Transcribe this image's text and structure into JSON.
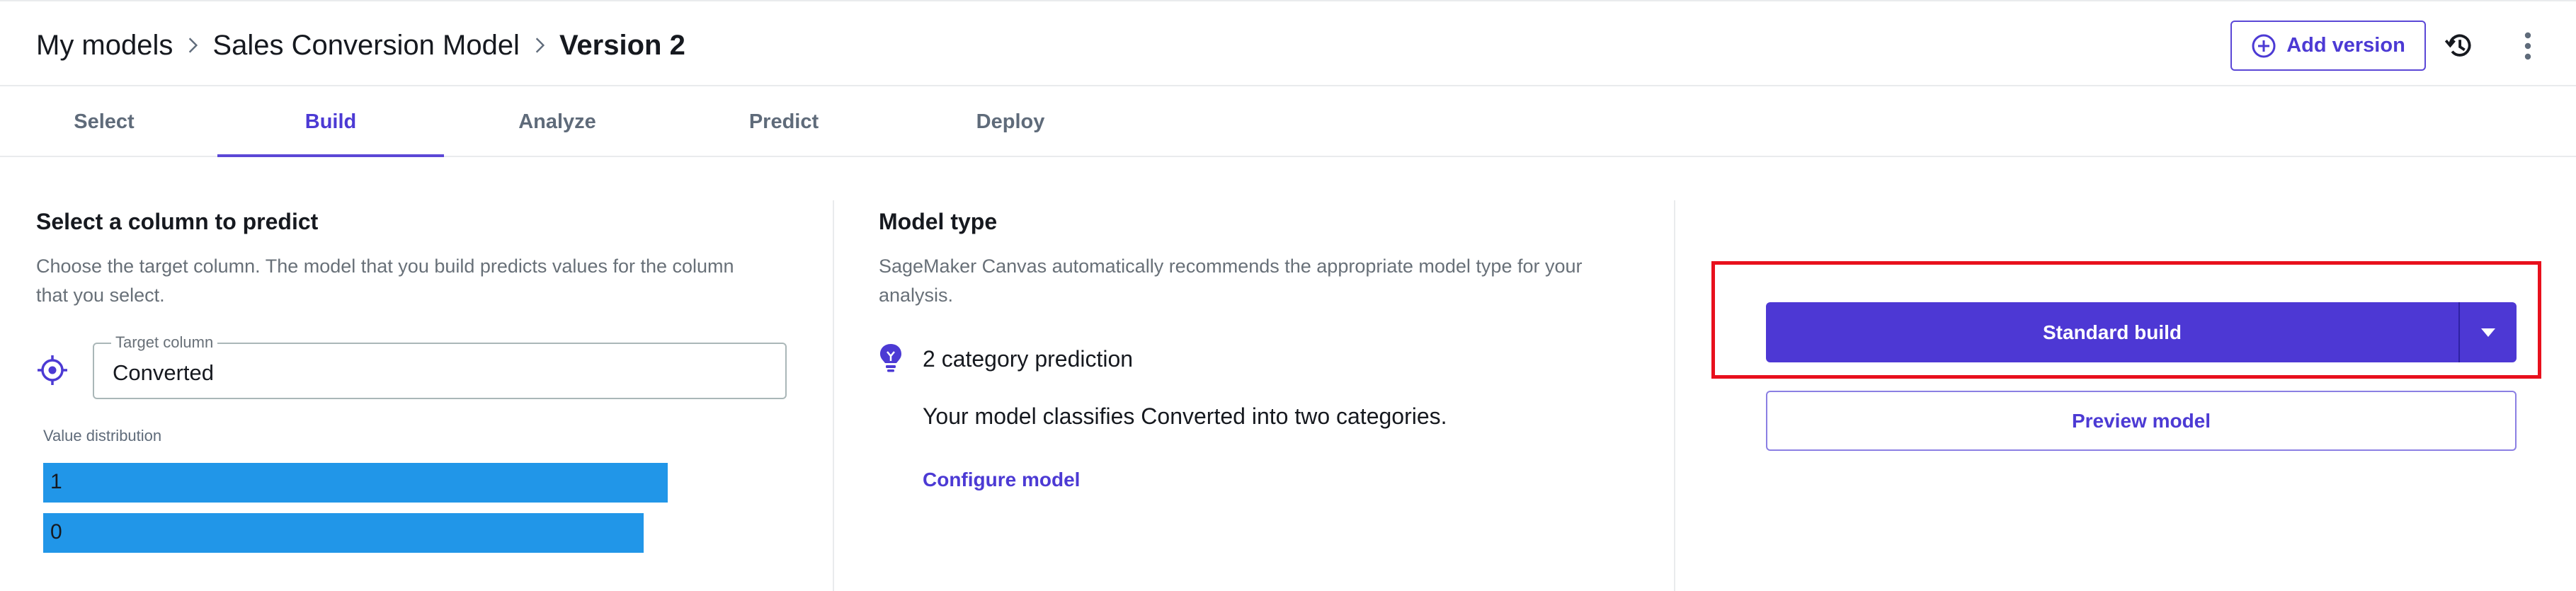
{
  "breadcrumb": {
    "items": [
      "My models",
      "Sales Conversion Model"
    ],
    "current": "Version 2"
  },
  "header": {
    "add_version_label": "Add version",
    "history_icon": "history-icon",
    "more_icon": "kebab-menu-icon"
  },
  "tabs": [
    "Select",
    "Build",
    "Analyze",
    "Predict",
    "Deploy"
  ],
  "active_tab": "Build",
  "predict_column": {
    "title": "Select a column to predict",
    "description_line1": "Choose the target column. The model that you build predicts values for the column",
    "description_line2": "that you select.",
    "target_label": "Target column",
    "target_value": "Converted",
    "value_distribution_label": "Value distribution",
    "distribution": [
      {
        "label": "1",
        "fraction": 0.51
      },
      {
        "label": "0",
        "fraction": 0.49
      }
    ]
  },
  "model_type": {
    "title": "Model type",
    "description_line1": "SageMaker Canvas automatically recommends the appropriate model type for your",
    "description_line2": "analysis.",
    "prediction_type": "2 category prediction",
    "prediction_description": "Your model classifies Converted into two categories.",
    "configure_label": "Configure model"
  },
  "actions": {
    "build_label": "Standard build",
    "preview_label": "Preview model"
  },
  "colors": {
    "accent": "#4d38d4",
    "bar": "#2196e8",
    "highlight": "#e8101d"
  }
}
